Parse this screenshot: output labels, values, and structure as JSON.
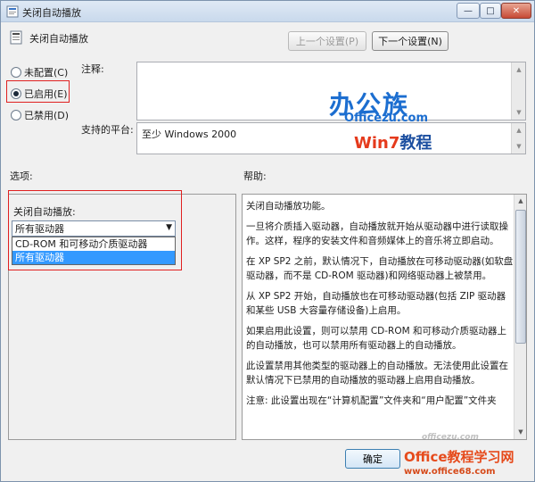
{
  "window": {
    "title": "关闭自动播放",
    "policy_name": "关闭自动播放",
    "controls": {
      "minimize": "—",
      "maximize": "□",
      "close": "✕"
    }
  },
  "nav": {
    "prev_label": "上一个设置(P)",
    "next_label": "下一个设置(N)"
  },
  "state": {
    "options": [
      {
        "label": "未配置(C)",
        "checked": false
      },
      {
        "label": "已启用(E)",
        "checked": true
      },
      {
        "label": "已禁用(D)",
        "checked": false
      }
    ]
  },
  "comment": {
    "label": "注释:",
    "value": ""
  },
  "supported": {
    "label": "支持的平台:",
    "value": "至少 Windows 2000"
  },
  "watermark": {
    "line1": "办公族",
    "line2": "Officezu.com",
    "line3_a": "Win7",
    "line3_b": "教程"
  },
  "sections": {
    "options_label": "选项:",
    "help_label": "帮助:"
  },
  "options_pane": {
    "combo_caption": "关闭自动播放:",
    "selected": "所有驱动器",
    "dropdown_items": [
      "CD-ROM 和可移动介质驱动器",
      "所有驱动器"
    ],
    "highlighted_index": 1
  },
  "help": {
    "paragraphs": [
      "关闭自动播放功能。",
      "一旦将介质插入驱动器，自动播放就开始从驱动器中进行读取操作。这样，程序的安装文件和音频媒体上的音乐将立即启动。",
      "在 XP SP2 之前，默认情况下，自动播放在可移动驱动器(如软盘驱动器，而不是 CD-ROM 驱动器)和网络驱动器上被禁用。",
      "从 XP SP2 开始，自动播放也在可移动驱动器(包括 ZIP 驱动器和某些 USB 大容量存储设备)上启用。",
      "如果启用此设置，则可以禁用 CD-ROM 和可移动介质驱动器上的自动播放，也可以禁用所有驱动器上的自动播放。",
      "此设置禁用其他类型的驱动器上的自动播放。无法使用此设置在默认情况下已禁用的自动播放的驱动器上启用自动播放。",
      "注意: 此设置出现在“计算机配置”文件夹和“用户配置”文件夹"
    ]
  },
  "footer": {
    "ok_label": "确定",
    "logo_top": "officezu.com",
    "logo_main": "Office教程学习网",
    "logo_url": "www.office68.com"
  }
}
